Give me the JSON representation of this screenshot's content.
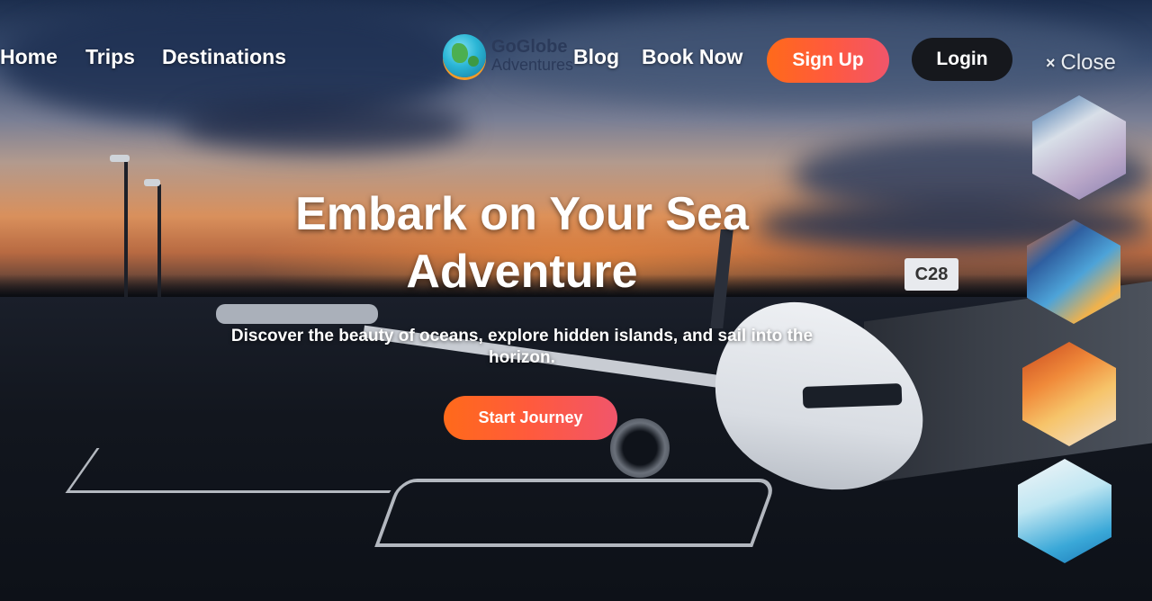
{
  "nav": {
    "links": [
      {
        "label": "Home"
      },
      {
        "label": "Trips"
      },
      {
        "label": "Destinations"
      },
      {
        "label": "Blog"
      },
      {
        "label": "Book Now"
      }
    ],
    "logo": {
      "line1": "GoGlobe",
      "line2": "Adventures",
      "icon": "globe-icon"
    },
    "signup_label": "Sign Up",
    "login_label": "Login",
    "close_label": "Close",
    "close_icon": "×"
  },
  "hero": {
    "title_line1": "Embark on Your Sea",
    "title_line2": "Adventure",
    "subtitle": "Discover the beauty of oceans, explore hidden islands, and sail into the horizon.",
    "cta_label": "Start Journey",
    "gate_sign": "C28"
  },
  "gallery": {
    "items": [
      {
        "icon": "ship-deck-image"
      },
      {
        "icon": "beach-umbrella-image"
      },
      {
        "icon": "desert-sunset-image"
      },
      {
        "icon": "pool-image"
      }
    ]
  },
  "colors": {
    "accent_start": "#ff6a1a",
    "accent_end": "#f1556b",
    "login_bg": "#16181d",
    "logo_text": "#2b3a5a"
  }
}
